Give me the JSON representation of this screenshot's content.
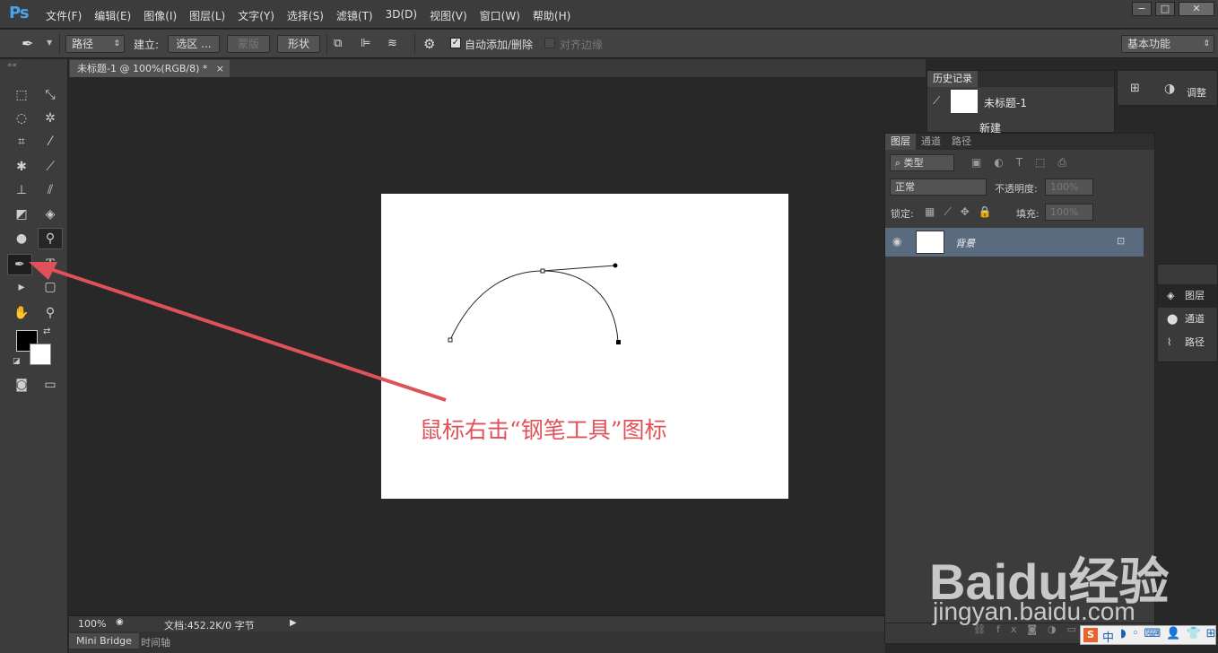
{
  "app": {
    "logo": "Ps",
    "menus": [
      "文件(F)",
      "编辑(E)",
      "图像(I)",
      "图层(L)",
      "文字(Y)",
      "选择(S)",
      "滤镜(T)",
      "3D(D)",
      "视图(V)",
      "窗口(W)",
      "帮助(H)"
    ],
    "window_buttons": [
      "−",
      "□",
      "✕"
    ]
  },
  "options": {
    "mode": "路径",
    "build_label": "建立:",
    "selection_btn": "选区 ...",
    "mask_btn": "蒙版",
    "shape_btn": "形状",
    "auto_add": "自动添加/删除",
    "align_edges": "对齐边缘",
    "workspace": "基本功能"
  },
  "document": {
    "tab_title": "未标题-1 @ 100%(RGB/8) *",
    "close": "×"
  },
  "annotation": {
    "text": "鼠标右击“钢笔工具”图标"
  },
  "status": {
    "zoom": "100%",
    "doc": "文档:452.2K/0 字节"
  },
  "bottom_tabs": [
    "Mini Bridge",
    "时间轴"
  ],
  "history": {
    "tab": "历史记录",
    "snapshot": "未标题-1",
    "item": "新建"
  },
  "layers": {
    "tabs": [
      "图层",
      "通道",
      "路径"
    ],
    "filter": "类型",
    "blend": "正常",
    "opacity_label": "不透明度:",
    "opacity": "100%",
    "lock_label": "锁定:",
    "fill_label": "填充:",
    "fill": "100%",
    "layer_name": "背景"
  },
  "right_dock": {
    "adjust": "调整",
    "items": [
      "图层",
      "通道",
      "路径"
    ]
  },
  "watermark": {
    "brand": "Baidu经验",
    "url": "jingyan.baidu.com"
  },
  "ime": {
    "label": "中"
  }
}
